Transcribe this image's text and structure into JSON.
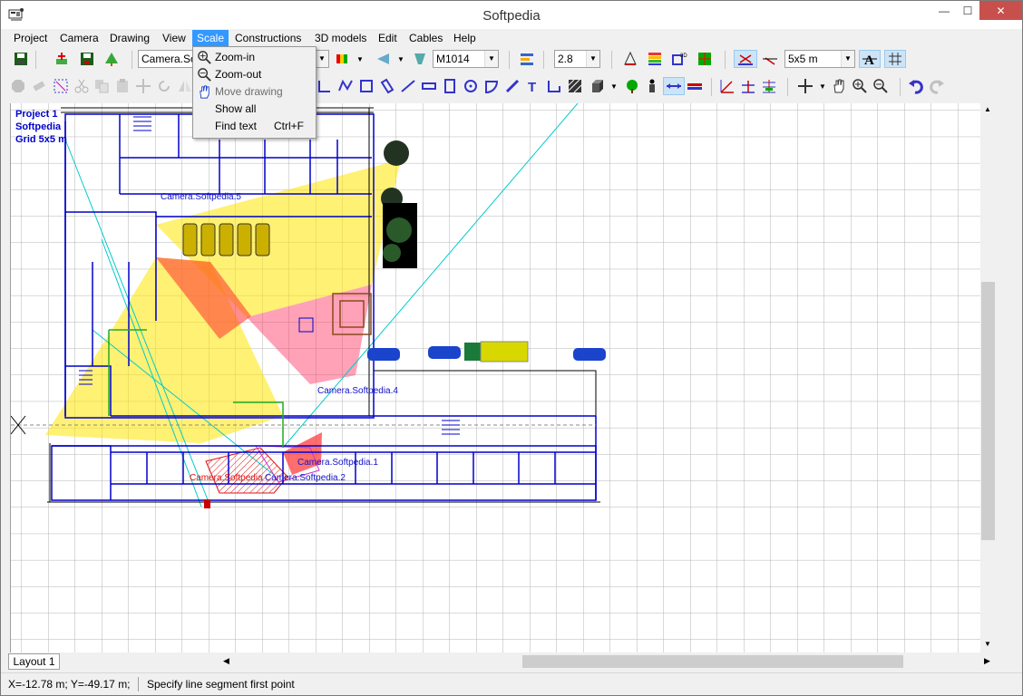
{
  "window": {
    "title": "Softpedia",
    "minimize_glyph": "—",
    "maximize_glyph": "☐",
    "close_glyph": "✕"
  },
  "menubar": {
    "items": [
      "Project",
      "Camera",
      "Drawing",
      "View",
      "Scale",
      "Constructions",
      "3D models",
      "Edit",
      "Cables",
      "Help"
    ],
    "active_item": "Scale"
  },
  "scale_menu": {
    "items": [
      {
        "label": "Zoom-in",
        "shortcut": "",
        "icon": "zoom-in-icon"
      },
      {
        "label": "Zoom-out",
        "shortcut": "",
        "icon": "zoom-out-icon"
      },
      {
        "label": "Move drawing",
        "shortcut": "",
        "icon": "hand-icon",
        "disabled": true
      },
      {
        "label": "Show all",
        "shortcut": ""
      },
      {
        "label": "Find text",
        "shortcut": "Ctrl+F"
      }
    ]
  },
  "toolbar": {
    "camera_select": "Camera.Softpedia.5",
    "model_select": "M1014",
    "focal_select": "2.8",
    "grid_select": "5x5 m"
  },
  "canvas_info": {
    "line1": "Project 1",
    "line2": "Softpedia",
    "line3": "Grid 5x5 m"
  },
  "camera_labels": {
    "cam5": "Camera.Softpedia.5",
    "cam4": "Camera.Softpedia.4",
    "cam1": "Camera.Softpedia.1",
    "cam2": "Camera.Softpedia.2",
    "cam3": "Camera.Softpedia"
  },
  "tabs": {
    "layout": "Layout 1"
  },
  "statusbar": {
    "coords": "X=-12.78 m; Y=-49.17 m;",
    "message": "Specify line segment first point"
  },
  "colors": {
    "accent": "#3399ff",
    "close": "#c7504d",
    "wall": "#0000cc",
    "camera_fov": "#ffe600",
    "camera_red": "#ff3030"
  }
}
